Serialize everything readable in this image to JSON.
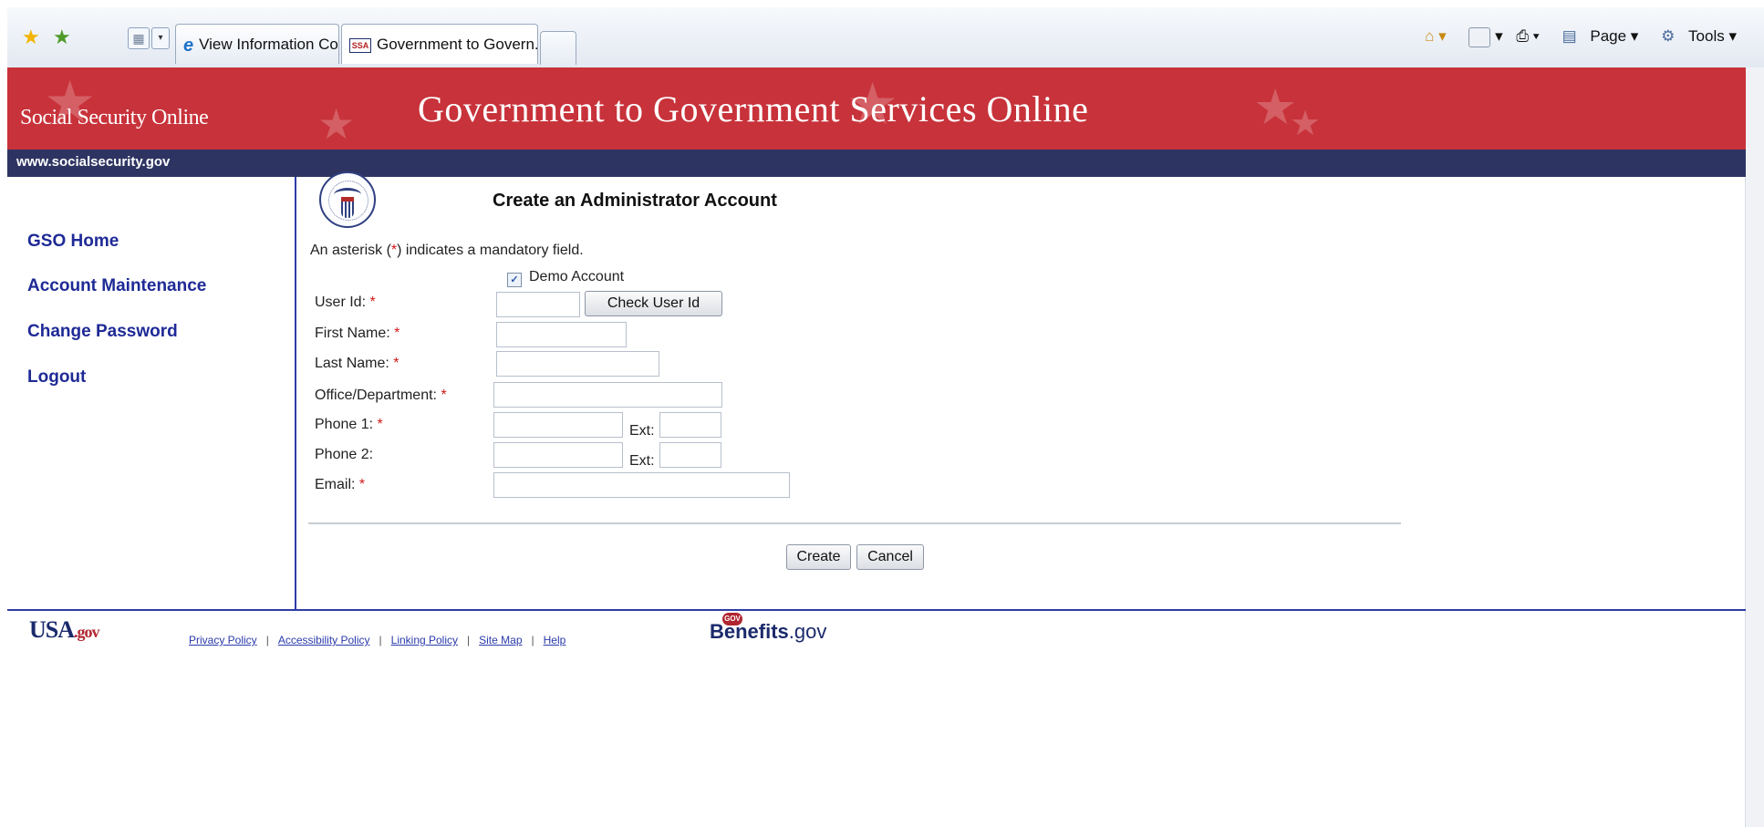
{
  "browser": {
    "tabs": [
      {
        "label": "View Information Collectio..."
      },
      {
        "label": "Government to Govern..."
      }
    ],
    "tools": {
      "page": "Page ▾",
      "tools": "Tools ▾"
    }
  },
  "banner": {
    "site_name": "Social Security Online",
    "title": "Government to Government Services Online",
    "url": "www.socialsecurity.gov"
  },
  "sidebar": {
    "items": [
      {
        "label": "GSO Home"
      },
      {
        "label": "Account Maintenance"
      },
      {
        "label": "Change Password"
      },
      {
        "label": "Logout"
      }
    ]
  },
  "form": {
    "title": "Create an Administrator Account",
    "note_prefix": "An asterisk (",
    "note_asterisk": "*",
    "note_suffix": ") indicates a mandatory field.",
    "demo_label": "Demo Account",
    "demo_checked": true,
    "fields": {
      "user_id": {
        "label": "User Id:",
        "value": ""
      },
      "first_name": {
        "label": "First Name:",
        "value": ""
      },
      "last_name": {
        "label": "Last Name:",
        "value": ""
      },
      "office": {
        "label": "Office/Department:",
        "value": ""
      },
      "phone1": {
        "label": "Phone 1:",
        "value": "",
        "ext": ""
      },
      "phone2": {
        "label": "Phone 2:",
        "value": "",
        "ext": ""
      },
      "email": {
        "label": "Email:",
        "value": ""
      }
    },
    "ext_label": "Ext:",
    "required_mark": "*",
    "check_user_id_label": "Check User Id",
    "create_label": "Create",
    "cancel_label": "Cancel"
  },
  "footer": {
    "usa_logo": "USA",
    "usa_gov": ".gov",
    "links": [
      "Privacy Policy",
      "Accessibility Policy",
      "Linking Policy",
      "Site Map",
      "Help"
    ],
    "benefits_badge": "GOV",
    "benefits_name": "Benefits",
    "benefits_gov": ".gov"
  },
  "colors": {
    "banner_red": "#c8323a",
    "nav_navy": "#2e3462",
    "link_blue": "#1e2a96"
  }
}
